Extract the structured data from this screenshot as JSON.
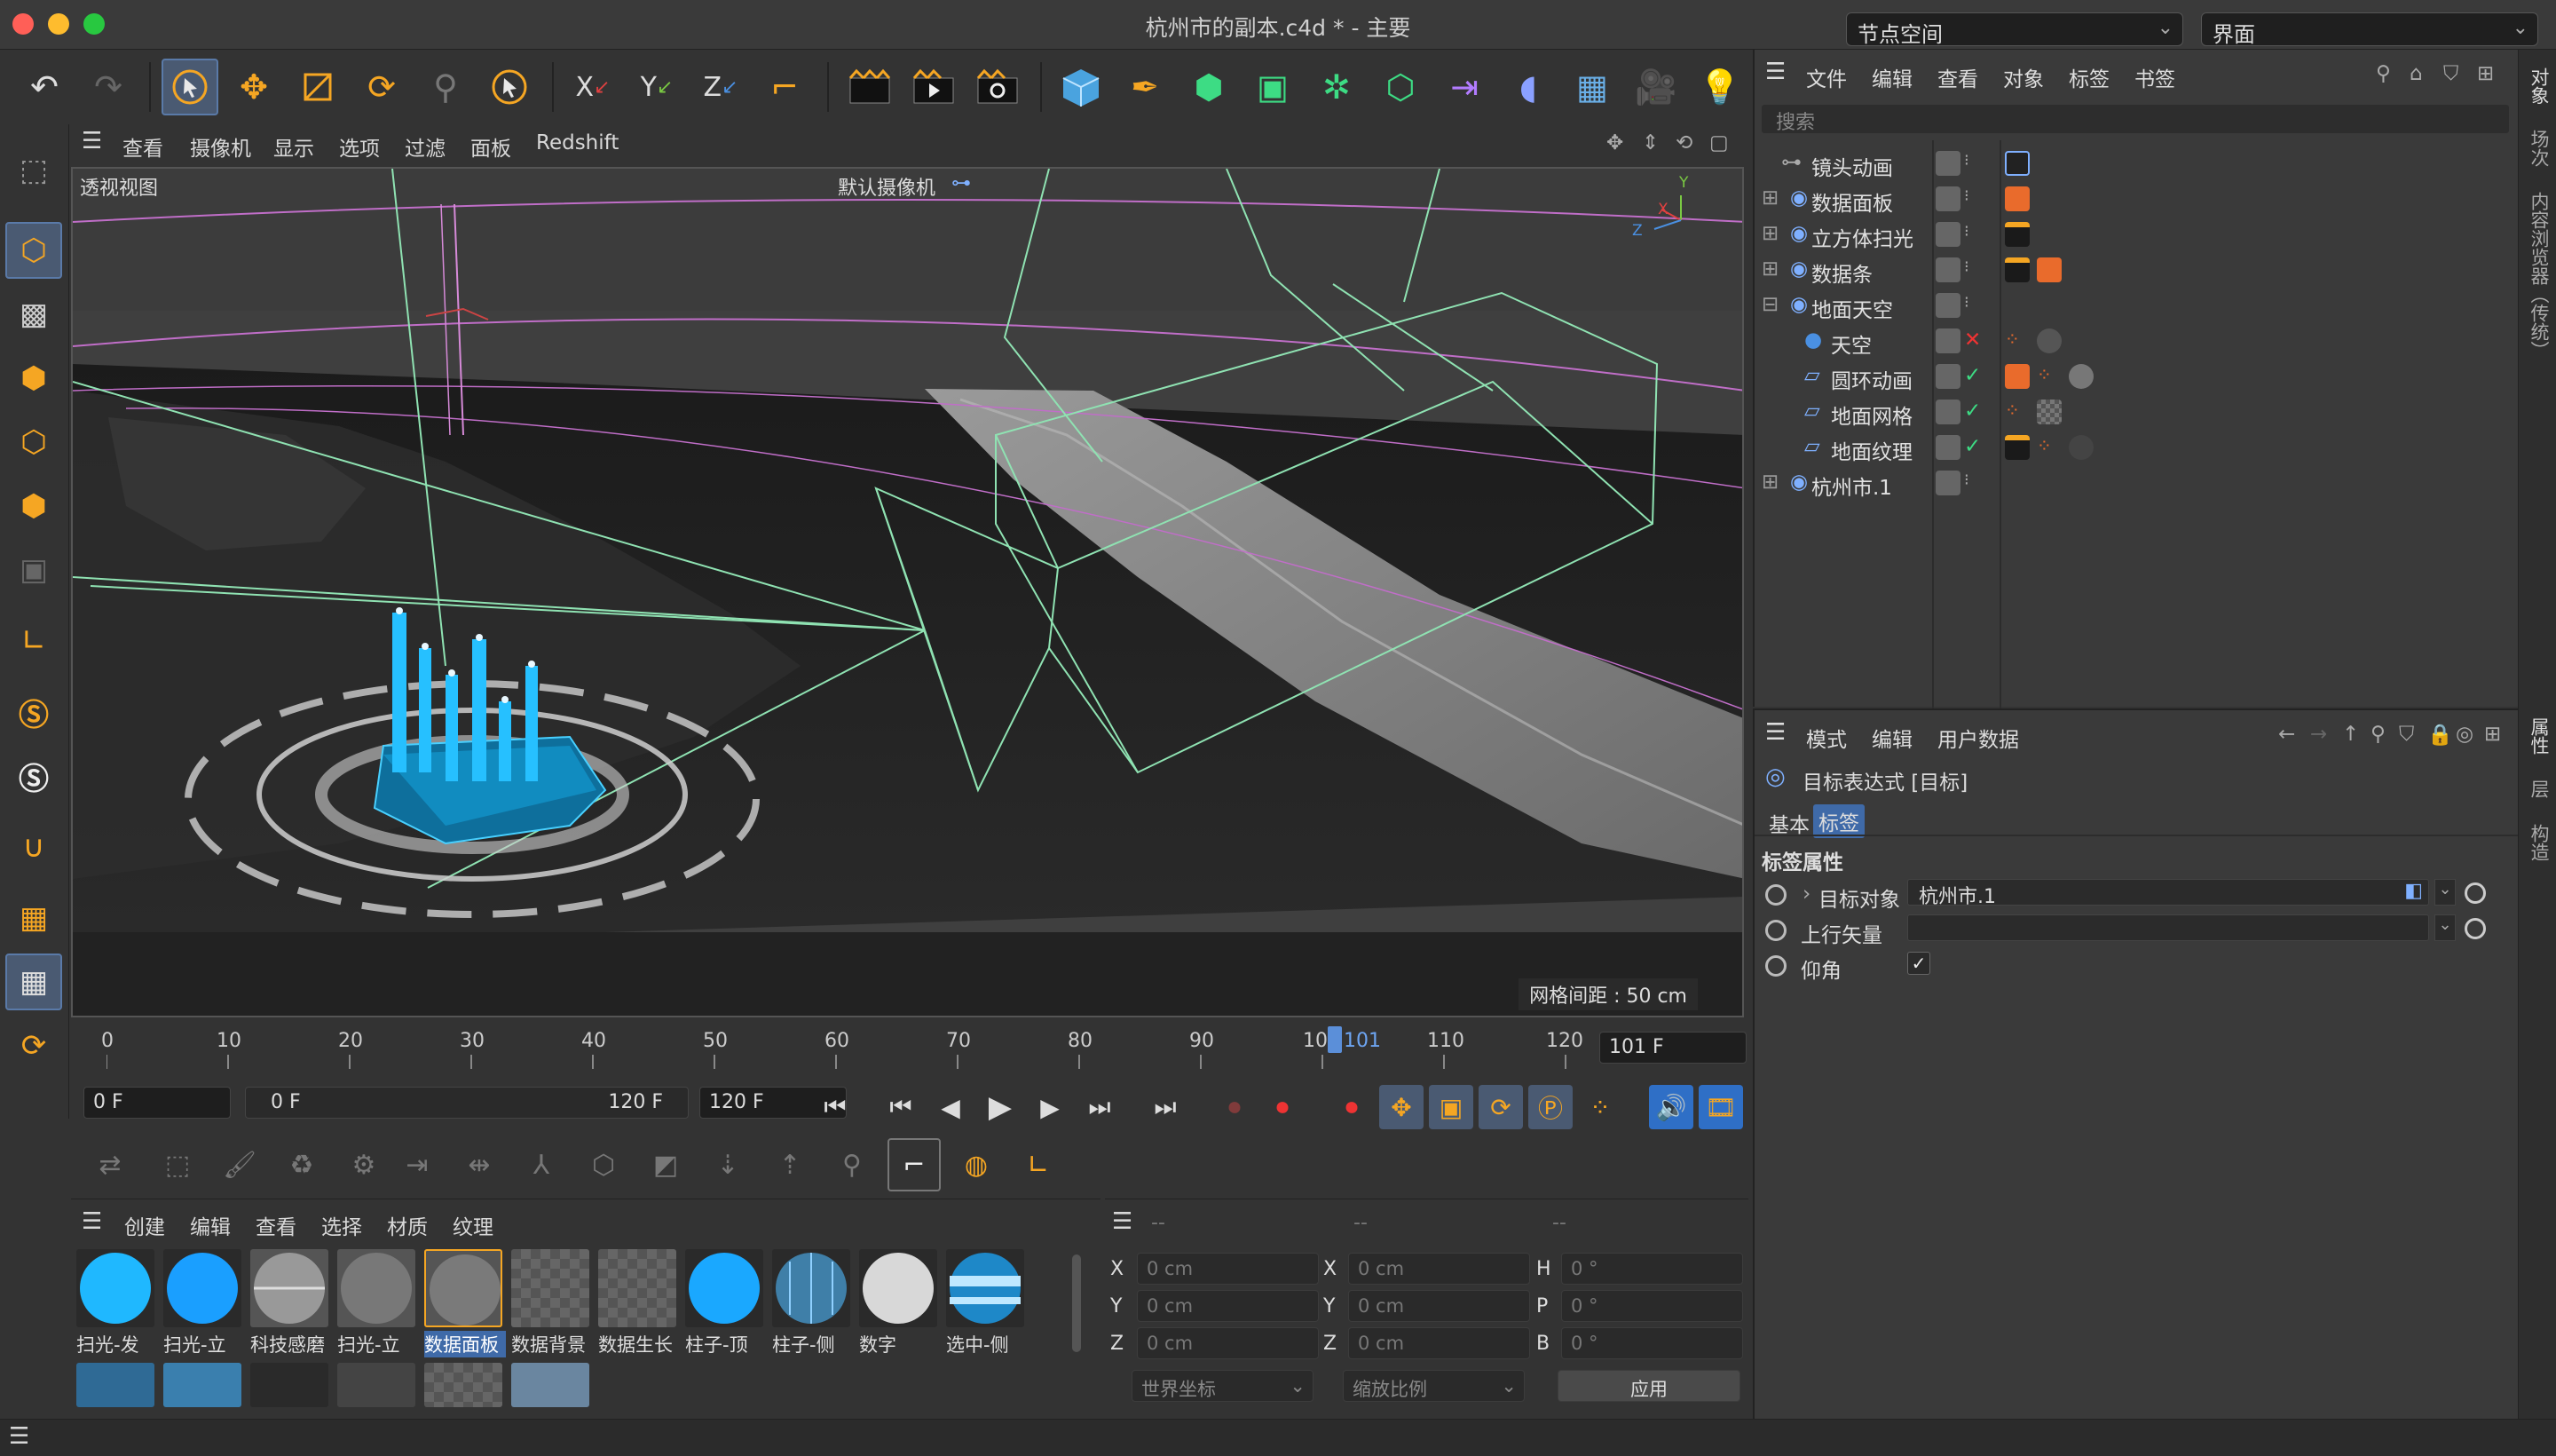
{
  "window": {
    "title": "杭州市的副本.c4d * - 主要",
    "node_space": "节点空间",
    "layout": "界面"
  },
  "viewport": {
    "menu": [
      "查看",
      "摄像机",
      "显示",
      "选项",
      "过滤",
      "面板",
      "Redshift"
    ],
    "view_name": "透视视图",
    "camera": "默认摄像机",
    "grid_spacing": "网格间距 : 50 cm",
    "axis_labels": {
      "y": "Y",
      "x": "X",
      "z": "Z"
    }
  },
  "timeline": {
    "ticks": [
      "0",
      "10",
      "20",
      "30",
      "40",
      "50",
      "60",
      "70",
      "80",
      "90",
      "10",
      "110",
      "120"
    ],
    "current_frame_marker": "101",
    "frame_field": "101 F",
    "start_field": "0 F",
    "range_start": "0 F",
    "range_end": "120 F",
    "end_field": "120 F"
  },
  "materials": {
    "menu": [
      "创建",
      "编辑",
      "查看",
      "选择",
      "材质",
      "纹理"
    ],
    "items": [
      "扫光-发",
      "扫光-立",
      "科技感磨",
      "扫光-立",
      "数据面板",
      "数据背景",
      "数据生长",
      "柱子-顶",
      "柱子-侧",
      "数字",
      "选中-侧"
    ]
  },
  "coords": {
    "headers": [
      "--",
      "--",
      "--"
    ],
    "rows": [
      {
        "a": "X",
        "av": "0 cm",
        "b": "X",
        "bv": "0 cm",
        "c": "H",
        "cv": "0 °"
      },
      {
        "a": "Y",
        "av": "0 cm",
        "b": "Y",
        "bv": "0 cm",
        "c": "P",
        "cv": "0 °"
      },
      {
        "a": "Z",
        "av": "0 cm",
        "b": "Z",
        "bv": "0 cm",
        "c": "B",
        "cv": "0 °"
      }
    ],
    "world": "世界坐标",
    "scale": "缩放比例",
    "apply": "应用"
  },
  "objects": {
    "menu": [
      "文件",
      "编辑",
      "查看",
      "对象",
      "标签",
      "书签"
    ],
    "search_placeholder": "搜索",
    "items": [
      "镜头动画",
      "数据面板",
      "立方体扫光",
      "数据条",
      "地面天空",
      "天空",
      "圆环动画",
      "地面网格",
      "地面纹理",
      "杭州市.1"
    ]
  },
  "attributes": {
    "menu": [
      "模式",
      "编辑",
      "用户数据"
    ],
    "title": "目标表达式 [目标]",
    "tabs": [
      "基本",
      "标签"
    ],
    "section": "标签属性",
    "target_label": "目标对象",
    "target_value": "杭州市.1",
    "up_label": "上行矢量",
    "pitch_label": "仰角"
  },
  "side_tabs": {
    "top": [
      "对象",
      "场次",
      "内容浏览器（传统）"
    ],
    "bottom": [
      "属性",
      "层",
      "构造"
    ]
  },
  "colors": {
    "accent": "#5a7aa8",
    "orange": "#f5a623",
    "cyan": "#1fb8ff",
    "green": "#7fe0b0"
  }
}
